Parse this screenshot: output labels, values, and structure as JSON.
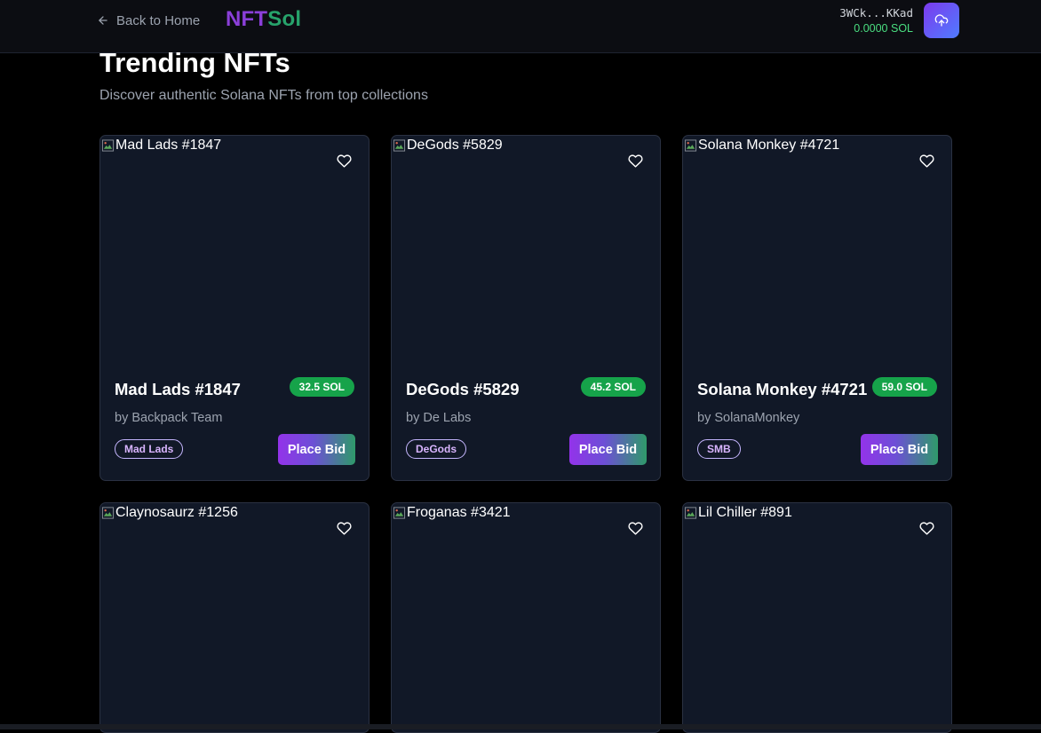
{
  "header": {
    "back_label": "Back to Home",
    "logo_part1": "NFT",
    "logo_part2": "Sol",
    "wallet_address": "3WCk...KKad",
    "wallet_balance": "0.0000 SOL",
    "upload_icon": "upload-cloud-icon"
  },
  "page": {
    "title": "Trending NFTs",
    "subtitle": "Discover authentic Solana NFTs from top collections"
  },
  "colors": {
    "accent_purple": "#8b3fd9",
    "accent_green": "#27a36b",
    "price_green": "#16a34a",
    "card_bg": "#111827"
  },
  "nfts": [
    {
      "alt": "Mad Lads #1847",
      "name": "Mad Lads #1847",
      "price": "32.5 SOL",
      "creator": "by Backpack Team",
      "collection": "Mad Lads",
      "bid_label": "Place Bid"
    },
    {
      "alt": "DeGods #5829",
      "name": "DeGods #5829",
      "price": "45.2 SOL",
      "creator": "by De Labs",
      "collection": "DeGods",
      "bid_label": "Place Bid"
    },
    {
      "alt": "Solana Monkey #4721",
      "name": "Solana Monkey #4721",
      "price": "59.0 SOL",
      "creator": "by SolanaMonkey",
      "collection": "SMB",
      "bid_label": "Place Bid"
    },
    {
      "alt": "Claynosaurz #1256"
    },
    {
      "alt": "Froganas #3421"
    },
    {
      "alt": "Lil Chiller #891"
    }
  ]
}
